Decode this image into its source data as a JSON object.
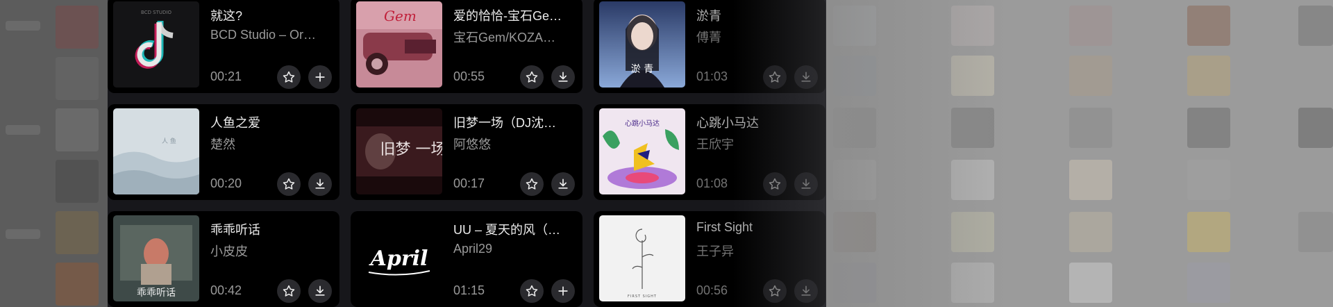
{
  "songs": [
    {
      "title": "就这?",
      "artist": "BCD Studio – Or…",
      "duration": "00:21",
      "action": "add-icon"
    },
    {
      "title": "爱的恰恰-宝石Ge…",
      "artist": "宝石Gem/KOZA…",
      "duration": "00:55",
      "action": "download-icon"
    },
    {
      "title": "淤青",
      "artist": "傅菁",
      "duration": "01:03",
      "action": "download-icon"
    },
    {
      "title": "人鱼之爱",
      "artist": "楚然",
      "duration": "00:20",
      "action": "download-icon"
    },
    {
      "title": "旧梦一场（DJ沈…",
      "artist": "阿悠悠",
      "duration": "00:17",
      "action": "download-icon"
    },
    {
      "title": "心跳小马达",
      "artist": "王欣宇",
      "duration": "01:08",
      "action": "download-icon"
    },
    {
      "title": "乖乖听话",
      "artist": "小皮皮",
      "duration": "00:42",
      "action": "download-icon"
    },
    {
      "title": "UU – 夏天的风（…",
      "artist": "April29",
      "duration": "01:15",
      "action": "add-icon"
    },
    {
      "title": "First Sight",
      "artist": "王子异",
      "duration": "00:56",
      "action": "download-icon"
    }
  ],
  "covers": {
    "c0_text": "BCD STUDIO",
    "c2_text": "淤 青",
    "c4_text": "旧梦 一场",
    "c5_text": "心跳小马达",
    "c6_text": "乖乖听话",
    "c7_text": "April",
    "c8_text": "FIRST SIGHT"
  },
  "colors": {
    "card_bg": "#000000",
    "panel_bg": "#17171b",
    "title": "#ececec",
    "meta": "#9a9a9a",
    "button_bg": "#2a2a2e"
  }
}
